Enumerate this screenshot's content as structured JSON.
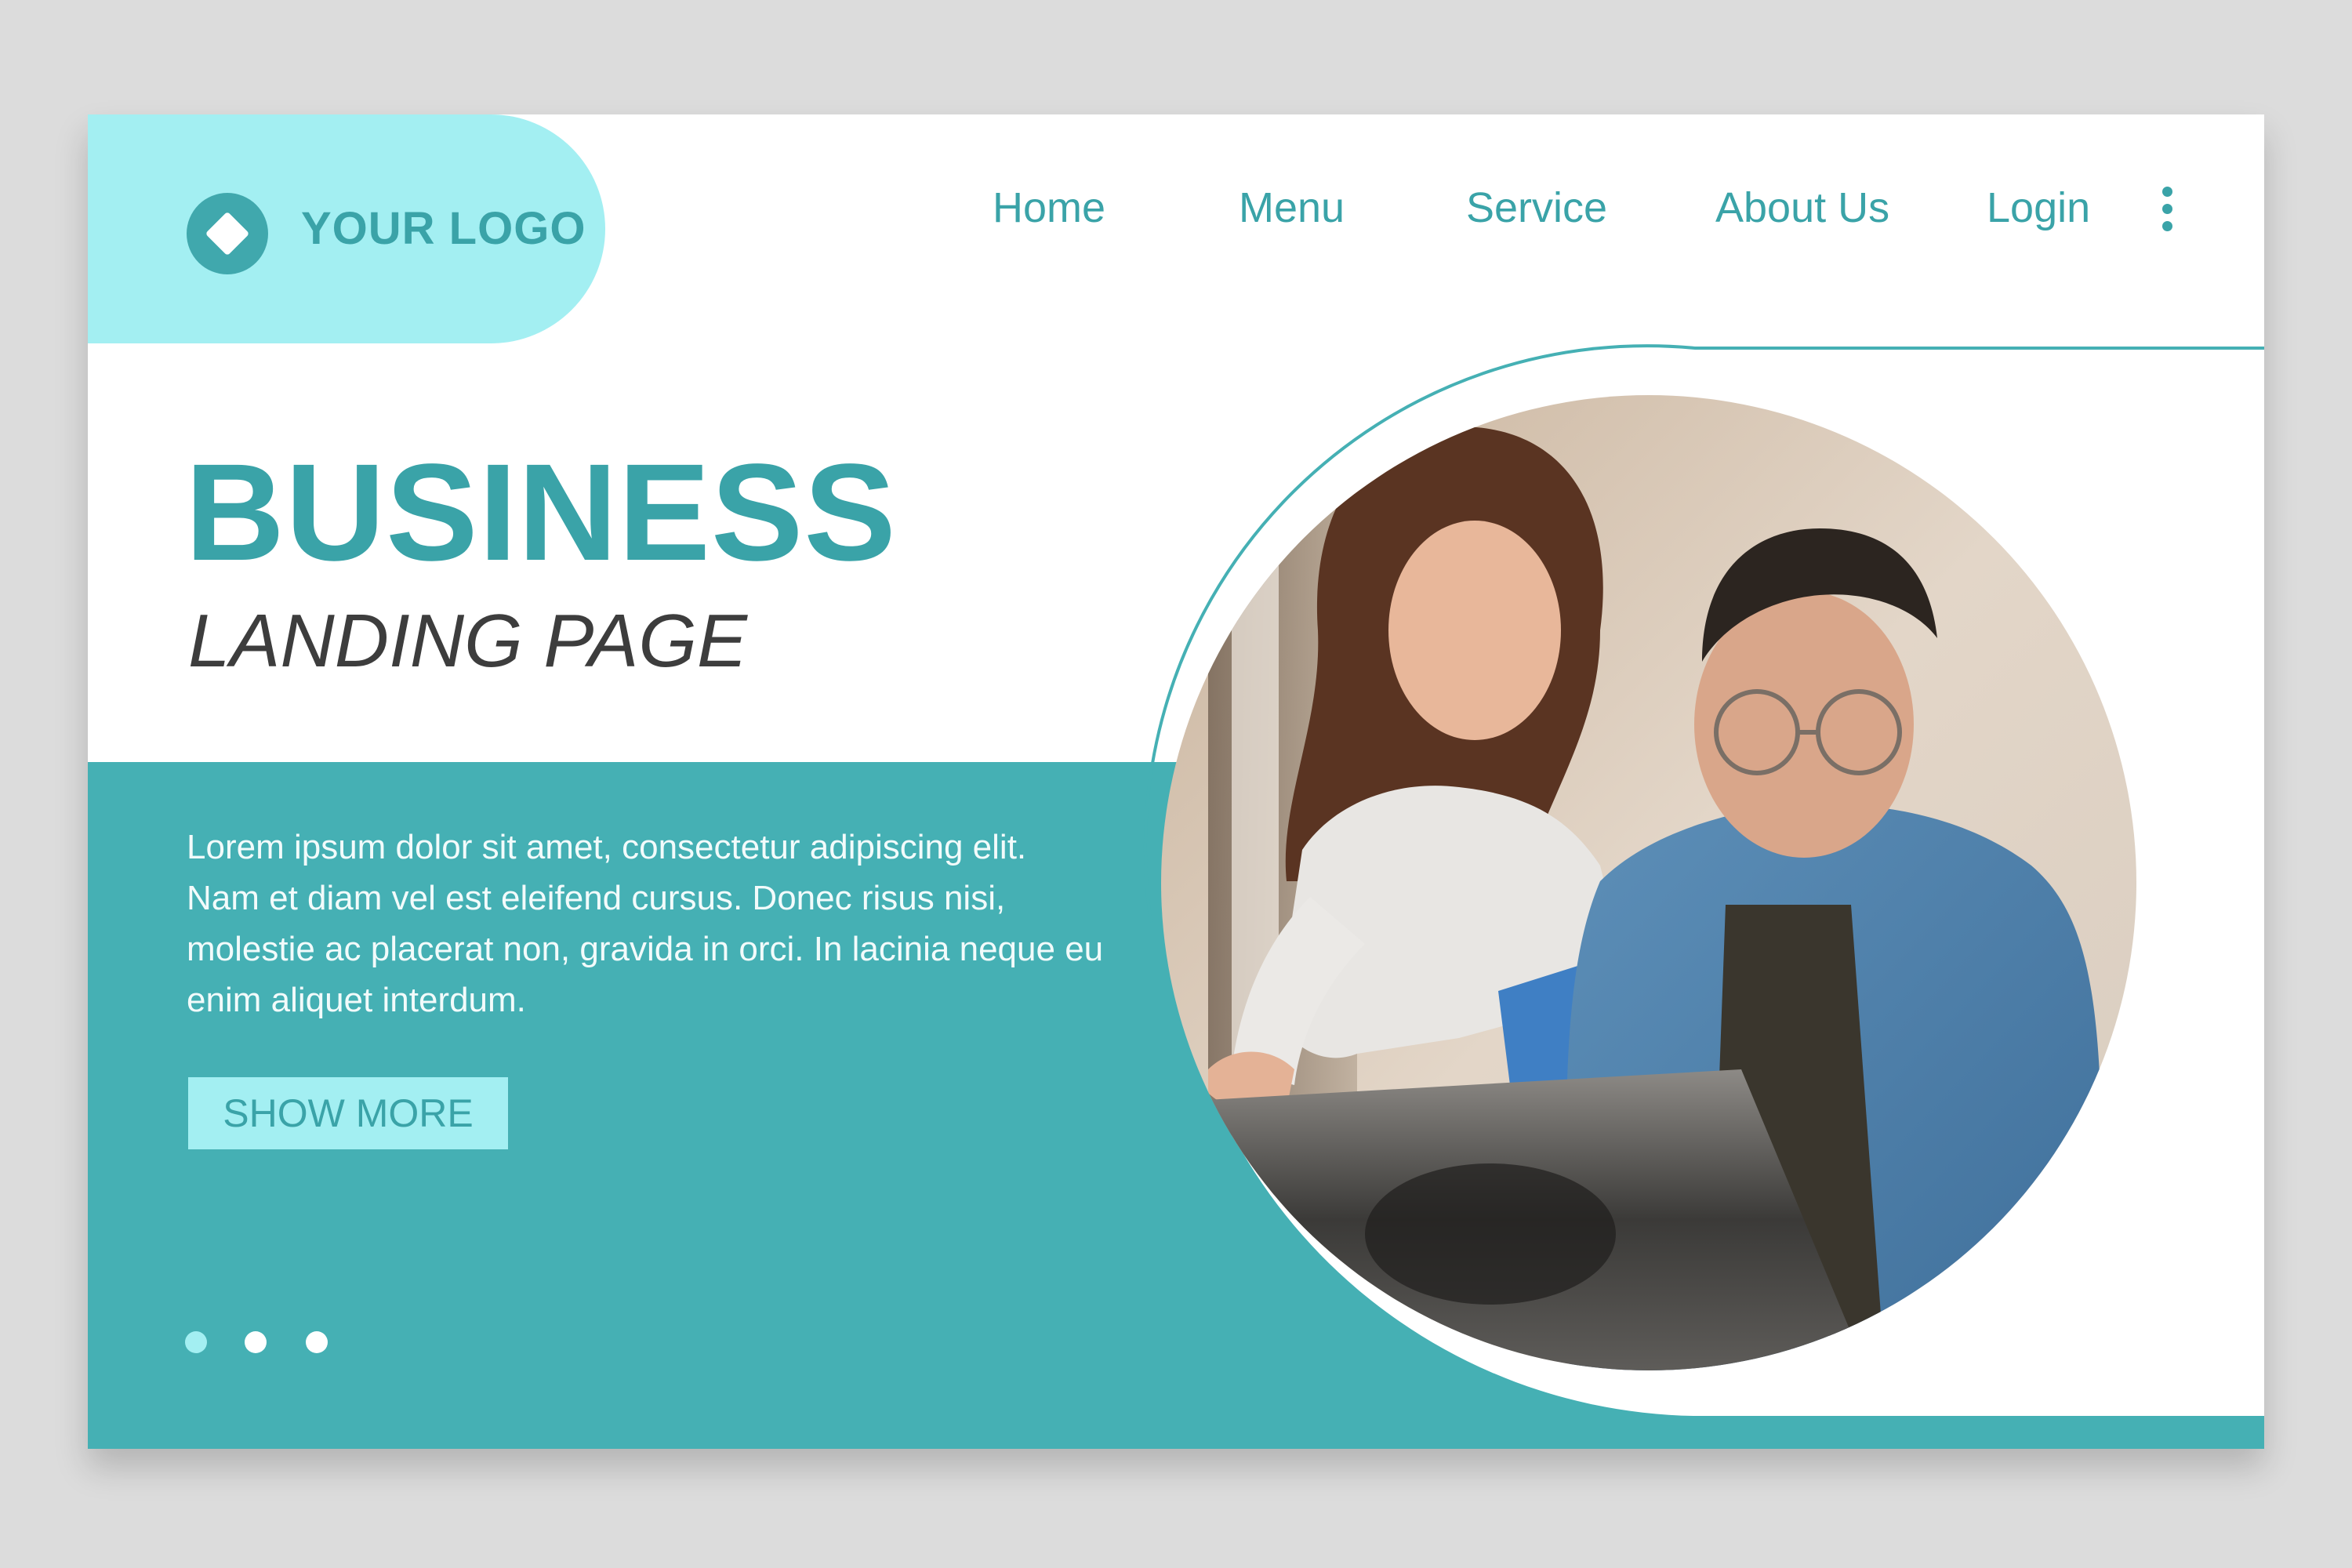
{
  "header": {
    "logo_text": "YOUR LOGO",
    "nav": [
      {
        "label": "Home"
      },
      {
        "label": "Menu"
      },
      {
        "label": "Service"
      },
      {
        "label": "About Us"
      },
      {
        "label": "Login"
      }
    ],
    "more_icon": "kebab-vertical-icon"
  },
  "hero": {
    "title": "BUSINESS",
    "subtitle": "LANDING PAGE",
    "body": "Lorem ipsum dolor sit amet, consectetur adipiscing elit. Nam et diam vel est eleifend cursus. Donec risus nisi, molestie ac placerat non, gravida in orci. In lacinia neque eu enim aliquet interdum.",
    "cta_label": "SHOW MORE",
    "carousel": {
      "count": 3,
      "active_index": 0
    },
    "image_alt": "woman-and-man-looking-at-laptop-photo"
  },
  "colors": {
    "teal": "#45b0b4",
    "teal_text": "#3aa3a8",
    "light_cyan": "#a3eff2",
    "white": "#ffffff",
    "dark_text": "#3d3d3d",
    "background": "#dcdcdc"
  }
}
